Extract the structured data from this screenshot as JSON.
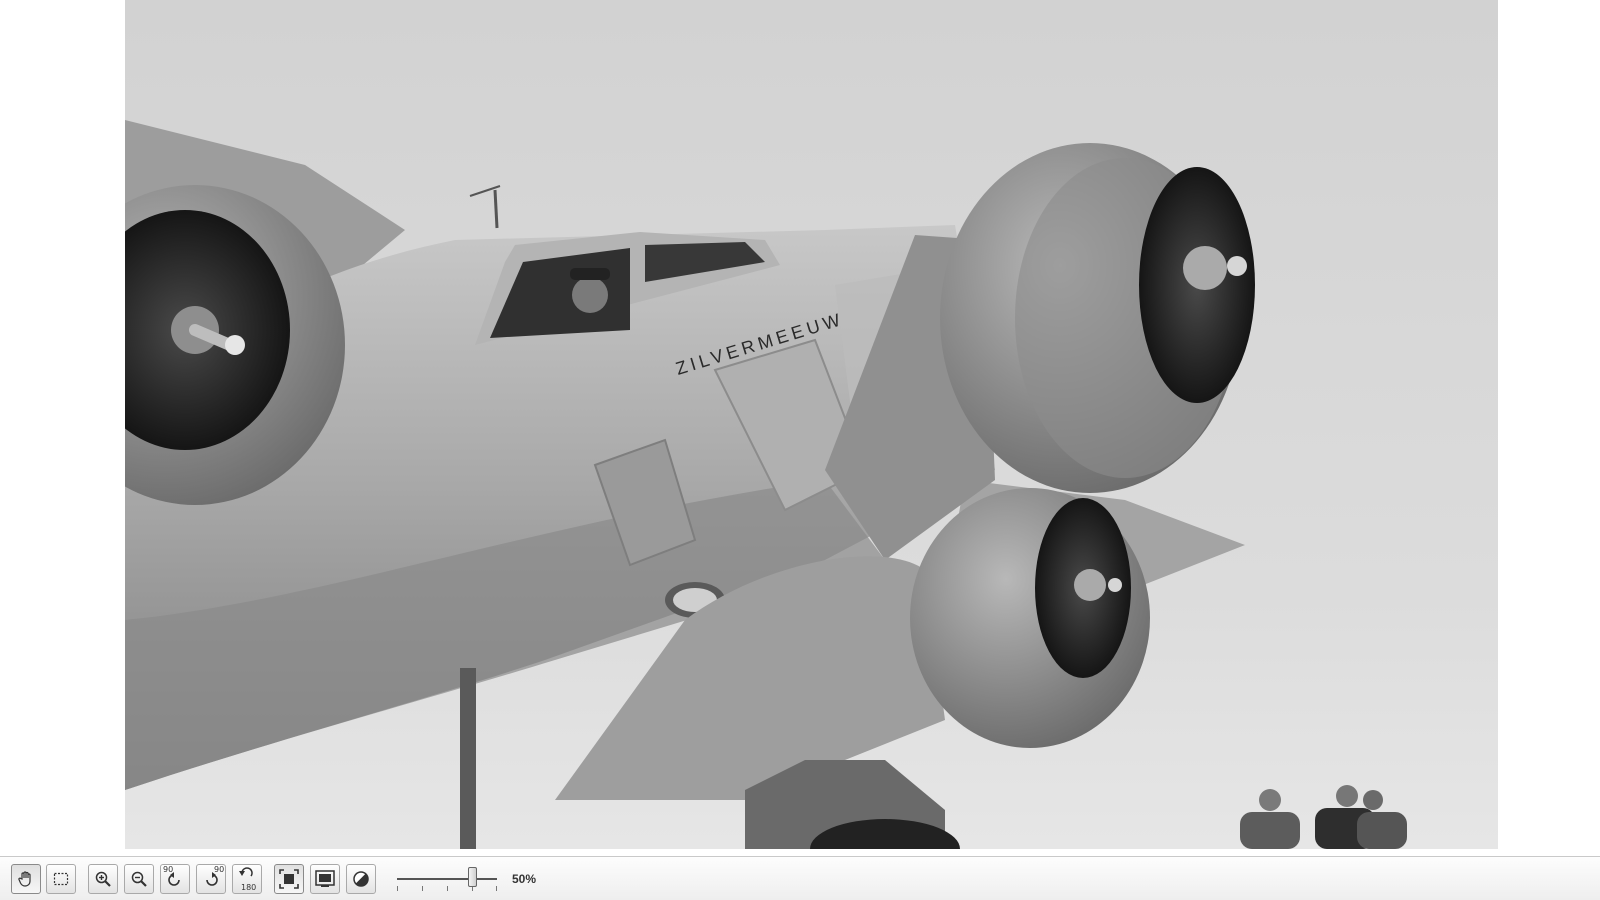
{
  "photo": {
    "aircraft_name": "ZILVERMEEUW"
  },
  "toolbar": {
    "tools": [
      {
        "name": "pan-tool",
        "icon": "hand-icon",
        "active": true
      },
      {
        "name": "select-area-tool",
        "icon": "marquee-select-icon",
        "active": false
      },
      {
        "name": "zoom-in",
        "icon": "zoom-in-icon",
        "active": false
      },
      {
        "name": "zoom-out",
        "icon": "zoom-out-icon",
        "active": false
      },
      {
        "name": "rotate-left-90",
        "icon": "rotate-left-icon",
        "active": false
      },
      {
        "name": "rotate-right-90",
        "icon": "rotate-right-icon",
        "active": false
      },
      {
        "name": "rotate-180",
        "icon": "rotate-180-icon",
        "active": false
      },
      {
        "name": "fit-to-window",
        "icon": "fit-window-icon",
        "active": false
      },
      {
        "name": "fullscreen",
        "icon": "fullscreen-icon",
        "active": false
      },
      {
        "name": "contrast",
        "icon": "contrast-icon",
        "active": false
      }
    ],
    "rotate_left_label": "90",
    "rotate_right_label": "90",
    "rotate_180_label": "180",
    "zoom_level": 0.5,
    "zoom_label": "50%"
  }
}
